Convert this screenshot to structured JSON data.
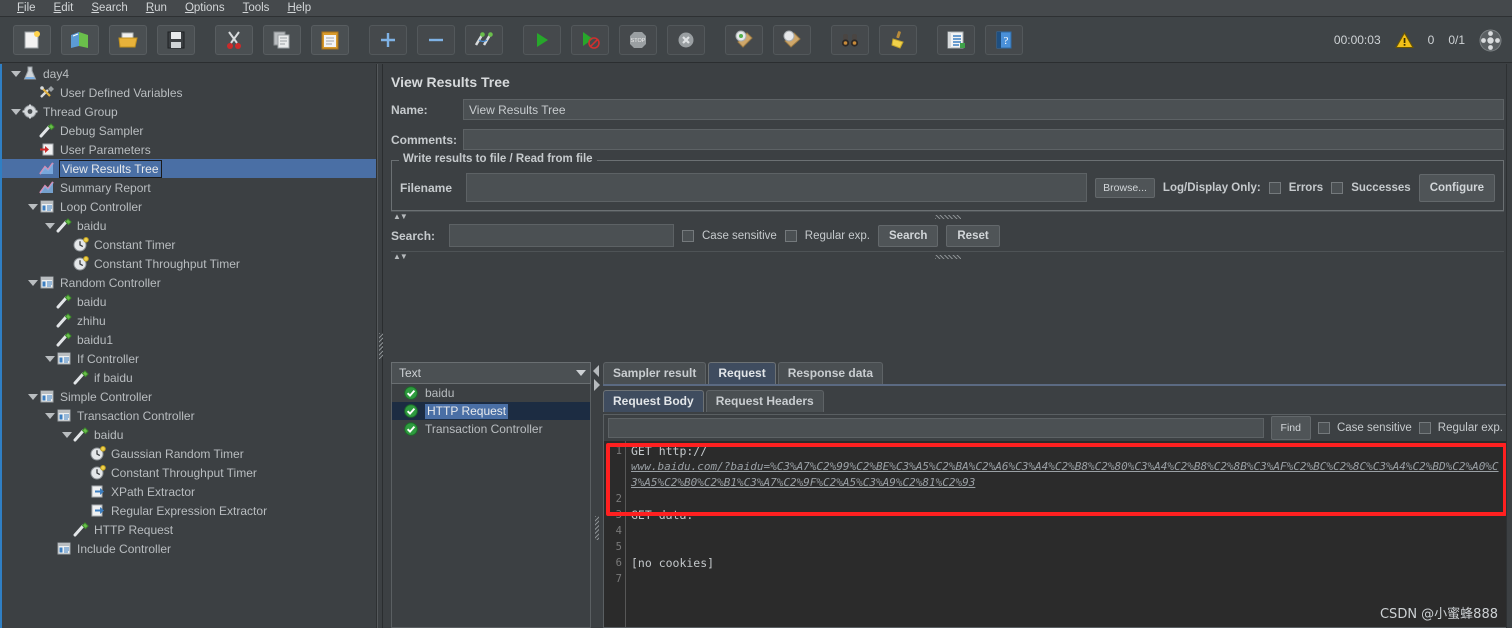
{
  "menubar": {
    "items": [
      {
        "label": "File",
        "mnemonic": "F"
      },
      {
        "label": "Edit",
        "mnemonic": "E"
      },
      {
        "label": "Search",
        "mnemonic": "S"
      },
      {
        "label": "Run",
        "mnemonic": "R"
      },
      {
        "label": "Options",
        "mnemonic": "O"
      },
      {
        "label": "Tools",
        "mnemonic": "T"
      },
      {
        "label": "Help",
        "mnemonic": "H"
      }
    ]
  },
  "toolbar": {
    "buttons": [
      {
        "name": "new-icon",
        "title": "New"
      },
      {
        "name": "templates-icon",
        "title": "Templates"
      },
      {
        "name": "open-icon",
        "title": "Open"
      },
      {
        "name": "save-icon",
        "title": "Save"
      },
      {
        "name": "cut-icon",
        "title": "Cut"
      },
      {
        "name": "copy-icon",
        "title": "Copy"
      },
      {
        "name": "paste-icon",
        "title": "Paste"
      },
      {
        "name": "expand-icon",
        "title": "Expand"
      },
      {
        "name": "collapse-icon",
        "title": "Collapse"
      },
      {
        "name": "toggle-icon",
        "title": "Toggle"
      },
      {
        "name": "start-icon",
        "title": "Start"
      },
      {
        "name": "start-no-pauses-icon",
        "title": "Start no pauses"
      },
      {
        "name": "stop-icon",
        "title": "Stop"
      },
      {
        "name": "shutdown-icon",
        "title": "Shutdown"
      },
      {
        "name": "clear-icon",
        "title": "Clear"
      },
      {
        "name": "clear-all-icon",
        "title": "Clear All"
      },
      {
        "name": "search-binoculars-icon",
        "title": "Search"
      },
      {
        "name": "reset-search-icon",
        "title": "Reset Search"
      },
      {
        "name": "function-helper-icon",
        "title": "Function Helper Dialog"
      },
      {
        "name": "help-icon",
        "title": "Help"
      }
    ],
    "elapsed_time": "00:00:03",
    "warning_count": "0",
    "thread_count": "0/1"
  },
  "tree": {
    "nodes": [
      {
        "label": "day4",
        "indent": 0,
        "icon": "test-plan-icon",
        "twisty": "open",
        "selected": false
      },
      {
        "label": "User Defined Variables",
        "indent": 1,
        "icon": "config-element-icon",
        "twisty": "none",
        "selected": false
      },
      {
        "label": "Thread Group",
        "indent": 0,
        "icon": "thread-group-icon",
        "twisty": "open",
        "selected": false
      },
      {
        "label": "Debug Sampler",
        "indent": 1,
        "icon": "sampler-icon",
        "twisty": "none",
        "selected": false
      },
      {
        "label": "User Parameters",
        "indent": 1,
        "icon": "pre-processor-icon",
        "twisty": "none",
        "selected": false
      },
      {
        "label": "View Results Tree",
        "indent": 1,
        "icon": "listener-icon",
        "twisty": "none",
        "selected": true
      },
      {
        "label": "Summary Report",
        "indent": 1,
        "icon": "listener-icon",
        "twisty": "none",
        "selected": false
      },
      {
        "label": "Loop Controller",
        "indent": 1,
        "icon": "controller-icon",
        "twisty": "open",
        "selected": false
      },
      {
        "label": "baidu",
        "indent": 2,
        "icon": "sampler-icon",
        "twisty": "open",
        "selected": false
      },
      {
        "label": "Constant Timer",
        "indent": 3,
        "icon": "timer-icon",
        "twisty": "none",
        "selected": false
      },
      {
        "label": "Constant Throughput Timer",
        "indent": 3,
        "icon": "timer-icon",
        "twisty": "none",
        "selected": false
      },
      {
        "label": "Random Controller",
        "indent": 1,
        "icon": "controller-icon",
        "twisty": "open",
        "selected": false
      },
      {
        "label": "baidu",
        "indent": 2,
        "icon": "sampler-icon",
        "twisty": "none",
        "selected": false
      },
      {
        "label": "zhihu",
        "indent": 2,
        "icon": "sampler-icon",
        "twisty": "none",
        "selected": false
      },
      {
        "label": "baidu1",
        "indent": 2,
        "icon": "sampler-icon",
        "twisty": "none",
        "selected": false
      },
      {
        "label": "If Controller",
        "indent": 2,
        "icon": "controller-icon",
        "twisty": "open",
        "selected": false
      },
      {
        "label": "if baidu",
        "indent": 3,
        "icon": "sampler-icon",
        "twisty": "none",
        "selected": false
      },
      {
        "label": "Simple Controller",
        "indent": 1,
        "icon": "controller-icon",
        "twisty": "open",
        "selected": false
      },
      {
        "label": "Transaction Controller",
        "indent": 2,
        "icon": "controller-icon",
        "twisty": "open",
        "selected": false
      },
      {
        "label": "baidu",
        "indent": 3,
        "icon": "sampler-icon",
        "twisty": "open",
        "selected": false
      },
      {
        "label": "Gaussian Random Timer",
        "indent": 4,
        "icon": "timer-icon",
        "twisty": "none",
        "selected": false
      },
      {
        "label": "Constant Throughput Timer",
        "indent": 4,
        "icon": "timer-icon",
        "twisty": "none",
        "selected": false
      },
      {
        "label": "XPath Extractor",
        "indent": 4,
        "icon": "post-processor-icon",
        "twisty": "none",
        "selected": false
      },
      {
        "label": "Regular Expression Extractor",
        "indent": 4,
        "icon": "post-processor-icon",
        "twisty": "none",
        "selected": false
      },
      {
        "label": "HTTP Request",
        "indent": 3,
        "icon": "sampler-icon",
        "twisty": "none",
        "selected": false
      },
      {
        "label": "Include Controller",
        "indent": 2,
        "icon": "controller-icon",
        "twisty": "none",
        "selected": false
      }
    ]
  },
  "panel": {
    "title": "View Results Tree",
    "name_label": "Name:",
    "name_value": "View Results Tree",
    "comments_label": "Comments:",
    "comments_value": "",
    "comments_placeholder": "",
    "filegroup": {
      "title": "Write results to file / Read from file",
      "filename_label": "Filename",
      "filename_value": "",
      "browse_label": "Browse...",
      "logdisplay_label": "Log/Display Only:",
      "errors_label": "Errors",
      "errors_checked": false,
      "successes_label": "Successes",
      "successes_checked": false,
      "configure_label": "Configure"
    },
    "search": {
      "label": "Search:",
      "value": "",
      "case_sensitive_label": "Case sensitive",
      "case_sensitive_checked": false,
      "regular_exp_label": "Regular exp.",
      "regular_exp_checked": false,
      "search_button": "Search",
      "reset_button": "Reset"
    }
  },
  "results": {
    "renderer_selected": "Text",
    "renderer_options": [
      "Text"
    ],
    "items": [
      {
        "label": "baidu",
        "status": "success",
        "selected": false
      },
      {
        "label": "HTTP Request",
        "status": "success",
        "selected": true
      },
      {
        "label": "Transaction Controller",
        "status": "success",
        "selected": false
      }
    ]
  },
  "tabs": {
    "main": [
      {
        "label": "Sampler result",
        "active": false
      },
      {
        "label": "Request",
        "active": true
      },
      {
        "label": "Response data",
        "active": false
      }
    ],
    "sub": [
      {
        "label": "Request Body",
        "active": true
      },
      {
        "label": "Request Headers",
        "active": false
      }
    ]
  },
  "find": {
    "value": "",
    "find_button": "Find",
    "case_sensitive_label": "Case sensitive",
    "case_sensitive_checked": false,
    "regular_exp_label": "Regular exp.",
    "regular_exp_checked": false
  },
  "code": {
    "line_numbers": [
      "1",
      "2",
      "3",
      "4",
      "5",
      "6",
      "7"
    ],
    "line1_prefix": "GET http://",
    "line1_url": "www.baidu.com/?baidu=%C3%A7%C2%99%C2%BE%C3%A5%C2%BA%C2%A6%C3%A4%C2%B8%C2%80%C3%A4%C2%B8%C2%8B%C3%AF%C2%BC%C2%8C%C3%A4%C2%BD%C2%A0%C3%A5%C2%B0%C2%B1%C3%A7%C2%9F%C2%A5%C3%A9%C2%81%C2%93",
    "line3": "GET data:",
    "line6": "[no cookies]"
  },
  "colors": {
    "accent_blue": "#2f7fc4",
    "selection_blue": "#4a6fa5",
    "highlight_red": "#ff2020",
    "panel_bg": "#3c4043",
    "code_bg": "#2b2b2b",
    "success_green": "#2e9b3f"
  },
  "watermark": "CSDN @小蜜蜂888"
}
